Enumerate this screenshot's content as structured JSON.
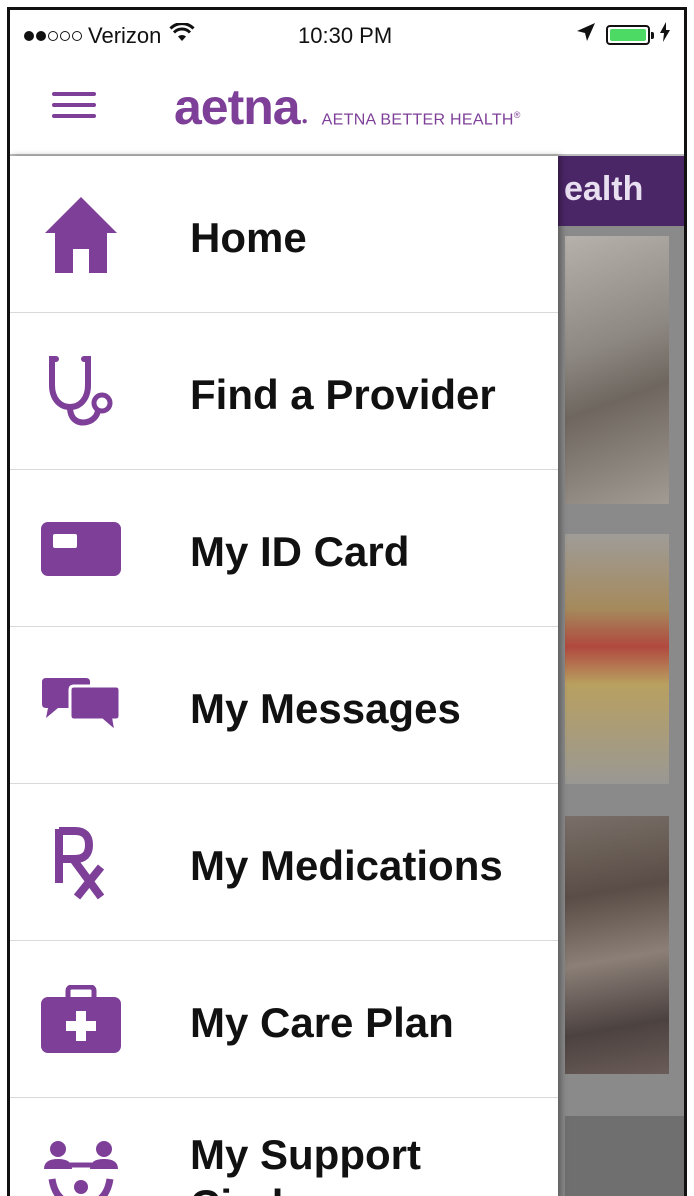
{
  "status_bar": {
    "carrier": "Verizon",
    "time": "10:30 PM",
    "signal_bars_filled": 2,
    "signal_bars_total": 5
  },
  "header": {
    "logo_text": "aetna",
    "logo_subtitle": "AETNA BETTER HEALTH",
    "logo_registered": "®"
  },
  "background": {
    "banner_text": "ealth"
  },
  "menu": {
    "items": [
      {
        "label": "Home",
        "icon": "home-icon"
      },
      {
        "label": "Find a Provider",
        "icon": "stethoscope-icon"
      },
      {
        "label": "My ID Card",
        "icon": "id-card-icon"
      },
      {
        "label": "My Messages",
        "icon": "messages-icon"
      },
      {
        "label": "My Medications",
        "icon": "rx-icon"
      },
      {
        "label": "My Care Plan",
        "icon": "medical-kit-icon"
      },
      {
        "label_line1": "My Support",
        "label_line2": "Circle",
        "icon": "support-circle-icon"
      }
    ]
  },
  "colors": {
    "brand_purple": "#7d3f98",
    "banner_purple": "#4b2667",
    "battery_green": "#4cd964"
  }
}
